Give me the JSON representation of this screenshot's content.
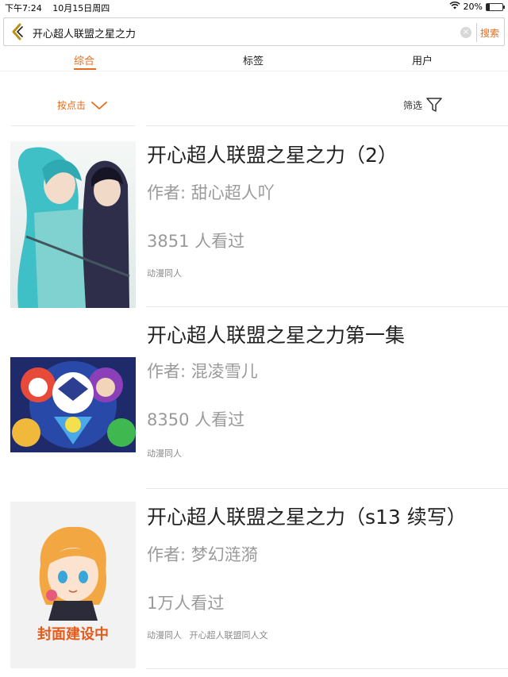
{
  "status_bar": {
    "time": "下午7:24",
    "date": "10月15日周四",
    "battery": "20%",
    "battery_level": 0.2
  },
  "search": {
    "query": "开心超人联盟之星之力",
    "button_label": "搜索"
  },
  "tabs": [
    {
      "label": "综合",
      "active": true
    },
    {
      "label": "标签",
      "active": false
    },
    {
      "label": "用户",
      "active": false
    }
  ],
  "filters": {
    "sort_label": "按点击",
    "filter_label": "筛选"
  },
  "results": [
    {
      "title": "开心超人联盟之星之力（2）",
      "author": "作者: 甜心超人吖",
      "views": "3851 人看过",
      "tags": [
        "动漫同人"
      ],
      "cover": "anime-characters-cover"
    },
    {
      "title": "开心超人联盟之星之力第一集",
      "author": "作者: 混凌雪儿",
      "views": "8350 人看过",
      "tags": [
        "动漫同人"
      ],
      "cover": "cartoon-heroes-cover"
    },
    {
      "title": "开心超人联盟之星之力（s13 续写）",
      "author": "作者: 梦幻涟漪",
      "views": "1万人看过",
      "tags": [
        "动漫同人",
        "开心超人联盟同人文"
      ],
      "cover": "placeholder-cover",
      "cover_text": "封面建设中"
    }
  ],
  "colors": {
    "accent": "#e66b1b",
    "text": "#222222",
    "muted": "#9a9a9a"
  }
}
